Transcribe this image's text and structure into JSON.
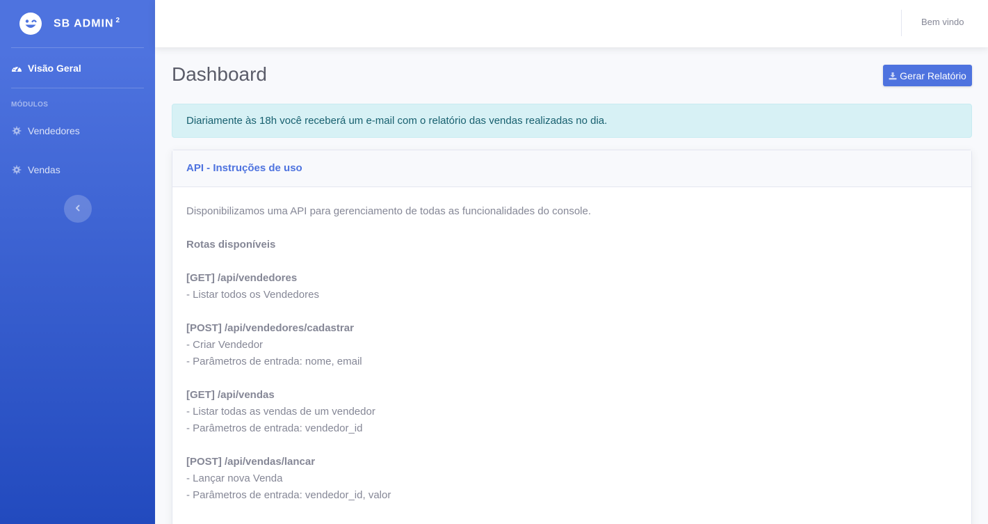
{
  "sidebar": {
    "brand": "SB Admin",
    "brand_sup": "2",
    "overview_label": "Visão Geral",
    "modules_heading": "Módulos",
    "items": [
      {
        "label": "Vendedores",
        "icon": "gear-icon"
      },
      {
        "label": "Vendas",
        "icon": "gear-icon"
      }
    ]
  },
  "topbar": {
    "user_greeting": "Bem vindo"
  },
  "page": {
    "title": "Dashboard",
    "report_button": "Gerar Relatório"
  },
  "alert": {
    "text": "Diariamente às 18h você receberá um e-mail com o relatório das vendas realizadas no dia."
  },
  "card": {
    "title": "API - Instruções de uso",
    "intro": "Disponibilizamos uma API para gerenciamento de todas as funcionalidades do console.",
    "routes_heading": "Rotas disponíveis",
    "routes": [
      {
        "route": "[GET] /api/vendedores",
        "lines": [
          "- Listar todos os Vendedores"
        ]
      },
      {
        "route": "[POST] /api/vendedores/cadastrar",
        "lines": [
          "- Criar Vendedor",
          "- Parâmetros de entrada: nome, email"
        ]
      },
      {
        "route": "[GET] /api/vendas",
        "lines": [
          "- Listar todas as vendas de um vendedor",
          "- Parâmetros de entrada: vendedor_id"
        ]
      },
      {
        "route": "[POST] /api/vendas/lancar",
        "lines": [
          "- Lançar nova Venda",
          "- Parâmetros de entrada: vendedor_id, valor"
        ]
      }
    ]
  },
  "colors": {
    "primary": "#4e73df",
    "primary_dark": "#224abe",
    "alert_bg": "#d7f1f5",
    "alert_text": "#18606f",
    "text_muted": "#858796",
    "heading": "#5a5c69"
  }
}
